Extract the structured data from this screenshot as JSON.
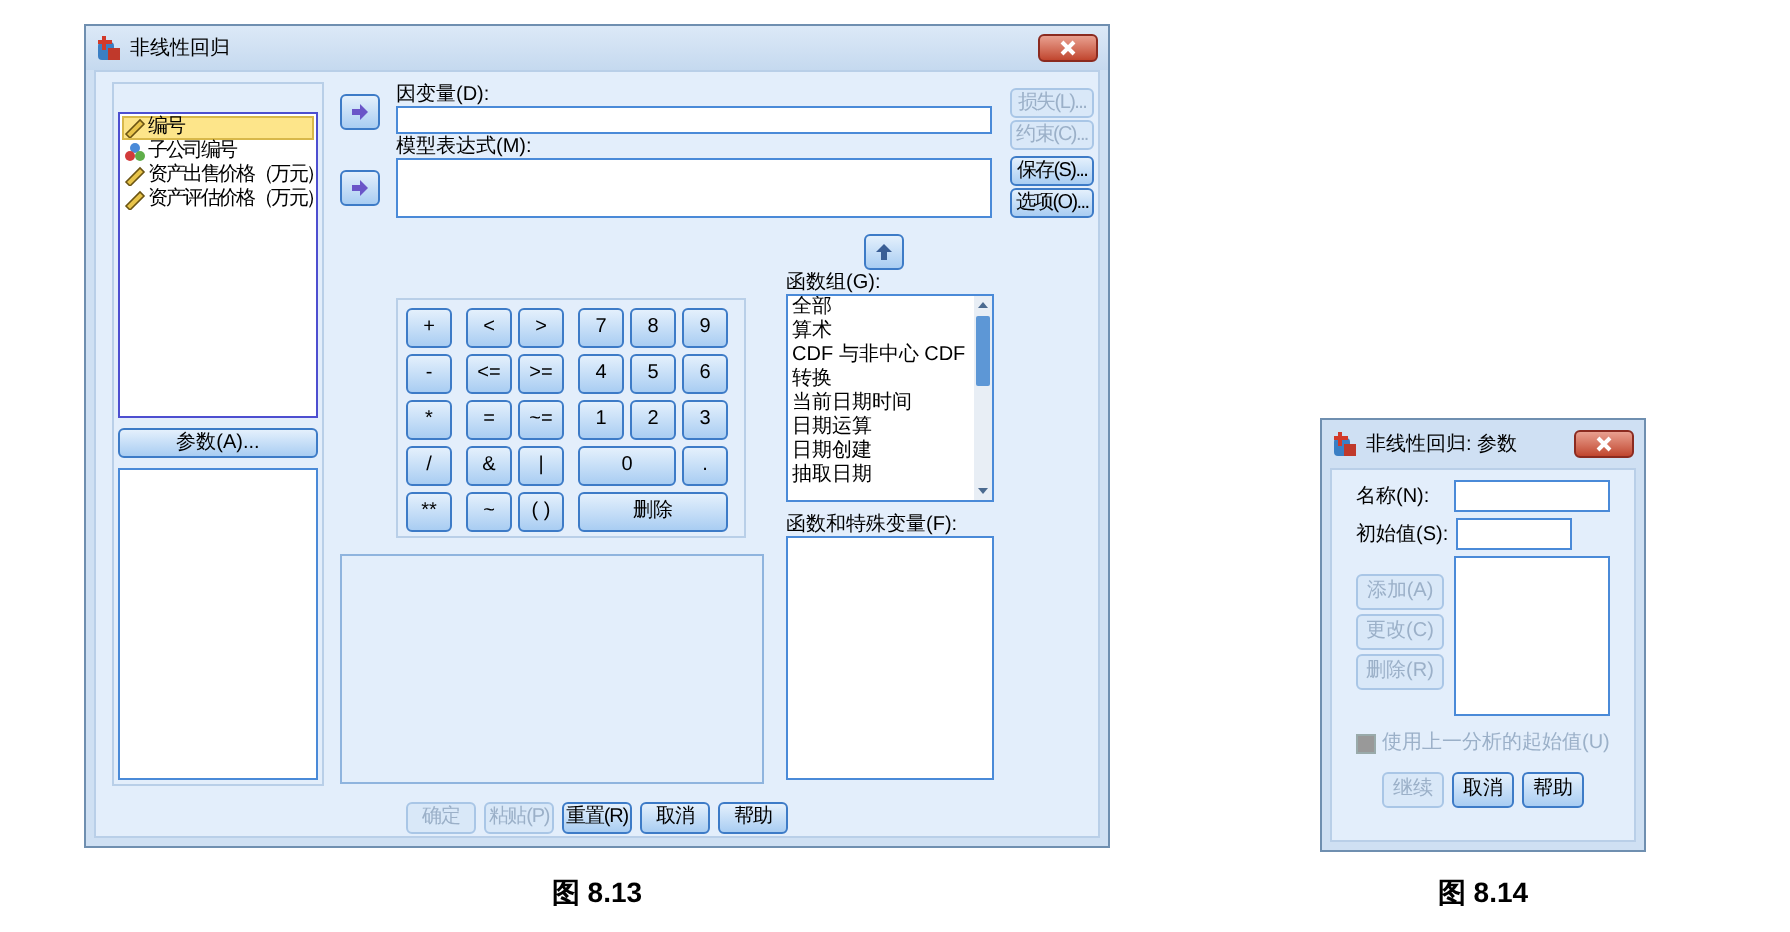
{
  "main_dialog": {
    "title": "非线性回归",
    "variables": [
      {
        "label": "编号",
        "kind": "scale",
        "selected": true
      },
      {
        "label": "子公司编号",
        "kind": "nominal",
        "selected": false
      },
      {
        "label": "资产出售价格（万元）",
        "kind": "scale",
        "selected": false
      },
      {
        "label": "资产评估价格（万元）",
        "kind": "scale",
        "selected": false
      }
    ],
    "params_button": "参数(A)...",
    "dependent_label": "因变量(D):",
    "model_label": "模型表达式(M):",
    "side_buttons": [
      {
        "label": "损失(L)...",
        "disabled": true
      },
      {
        "label": "约束(C)...",
        "disabled": true
      },
      {
        "label": "保存(S)...",
        "disabled": false
      },
      {
        "label": "选项(O)...",
        "disabled": false
      }
    ],
    "keypad": [
      [
        {
          "label": "+",
          "kind": "single"
        },
        {
          "label": "<",
          "kind": "single"
        },
        {
          "label": ">",
          "kind": "single"
        },
        {
          "label": "7",
          "kind": "single"
        },
        {
          "label": "8",
          "kind": "single"
        },
        {
          "label": "9",
          "kind": "single"
        }
      ],
      [
        {
          "label": "-",
          "kind": "single"
        },
        {
          "label": "<=",
          "kind": "single"
        },
        {
          "label": ">=",
          "kind": "single"
        },
        {
          "label": "4",
          "kind": "single"
        },
        {
          "label": "5",
          "kind": "single"
        },
        {
          "label": "6",
          "kind": "single"
        }
      ],
      [
        {
          "label": "*",
          "kind": "single"
        },
        {
          "label": "=",
          "kind": "single"
        },
        {
          "label": "~=",
          "kind": "single"
        },
        {
          "label": "1",
          "kind": "single"
        },
        {
          "label": "2",
          "kind": "single"
        },
        {
          "label": "3",
          "kind": "single"
        }
      ],
      [
        {
          "label": "/",
          "kind": "single"
        },
        {
          "label": "&",
          "kind": "single"
        },
        {
          "label": "|",
          "kind": "single"
        },
        {
          "label": "0",
          "kind": "double"
        },
        {
          "label": ".",
          "kind": "single"
        }
      ],
      [
        {
          "label": "**",
          "kind": "single"
        },
        {
          "label": "~",
          "kind": "single"
        },
        {
          "label": "( )",
          "kind": "single"
        },
        {
          "label": "删除",
          "kind": "triple"
        }
      ]
    ],
    "function_group_label": "函数组(G):",
    "function_groups": [
      "全部",
      "算术",
      "CDF 与非中心 CDF",
      "转换",
      "当前日期时间",
      "日期运算",
      "日期创建",
      "抽取日期"
    ],
    "functions_label": "函数和特殊变量(F):",
    "footer_buttons": [
      {
        "label": "确定",
        "disabled": true
      },
      {
        "label": "粘贴(P)",
        "disabled": true
      },
      {
        "label": "重置(R)",
        "disabled": false
      },
      {
        "label": "取消",
        "disabled": false
      },
      {
        "label": "帮助",
        "disabled": false
      }
    ],
    "caption": "图 8.13"
  },
  "params_dialog": {
    "title": "非线性回归: 参数",
    "name_label": "名称(N):",
    "initial_label": "初始值(S):",
    "side_buttons": [
      {
        "label": "添加(A)",
        "disabled": true
      },
      {
        "label": "更改(C)",
        "disabled": true
      },
      {
        "label": "删除(R)",
        "disabled": true
      }
    ],
    "checkbox": {
      "label": "使用上一分析的起始值(U)",
      "checked": false,
      "disabled": true
    },
    "footer_buttons": [
      {
        "label": "继续",
        "disabled": true
      },
      {
        "label": "取消",
        "disabled": false
      },
      {
        "label": "帮助",
        "disabled": false
      }
    ],
    "caption": "图 8.14"
  }
}
